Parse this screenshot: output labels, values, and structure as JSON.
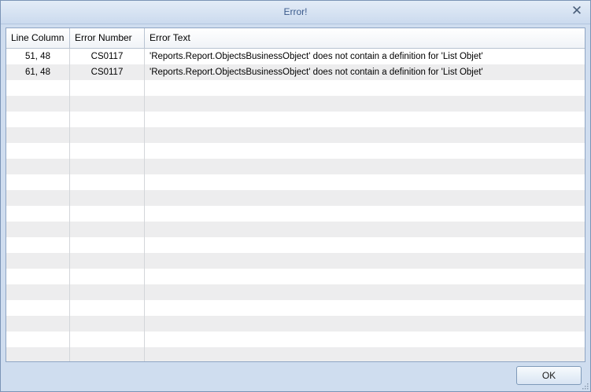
{
  "window": {
    "title": "Error!",
    "close_icon": "close-icon",
    "colors": {
      "frame": "#cfddef",
      "title_text": "#3b5b8c",
      "row_alt": "#ededee"
    }
  },
  "table": {
    "columns": [
      "Line Column",
      "Error Number",
      "Error Text"
    ],
    "rows": [
      {
        "line_column": "51, 48",
        "error_number": "CS0117",
        "error_text": "'Reports.Report.ObjectsBusinessObject' does not contain a definition for 'List  Objet'"
      },
      {
        "line_column": "61, 48",
        "error_number": "CS0117",
        "error_text": "'Reports.Report.ObjectsBusinessObject' does not contain a definition for 'List  Objet'"
      },
      {
        "line_column": "",
        "error_number": "",
        "error_text": ""
      },
      {
        "line_column": "",
        "error_number": "",
        "error_text": ""
      },
      {
        "line_column": "",
        "error_number": "",
        "error_text": ""
      },
      {
        "line_column": "",
        "error_number": "",
        "error_text": ""
      },
      {
        "line_column": "",
        "error_number": "",
        "error_text": ""
      },
      {
        "line_column": "",
        "error_number": "",
        "error_text": ""
      },
      {
        "line_column": "",
        "error_number": "",
        "error_text": ""
      },
      {
        "line_column": "",
        "error_number": "",
        "error_text": ""
      },
      {
        "line_column": "",
        "error_number": "",
        "error_text": ""
      },
      {
        "line_column": "",
        "error_number": "",
        "error_text": ""
      },
      {
        "line_column": "",
        "error_number": "",
        "error_text": ""
      },
      {
        "line_column": "",
        "error_number": "",
        "error_text": ""
      },
      {
        "line_column": "",
        "error_number": "",
        "error_text": ""
      },
      {
        "line_column": "",
        "error_number": "",
        "error_text": ""
      },
      {
        "line_column": "",
        "error_number": "",
        "error_text": ""
      },
      {
        "line_column": "",
        "error_number": "",
        "error_text": ""
      },
      {
        "line_column": "",
        "error_number": "",
        "error_text": ""
      },
      {
        "line_column": "",
        "error_number": "",
        "error_text": ""
      }
    ]
  },
  "footer": {
    "ok_label": "OK",
    "resize_icon": "resize-grip-icon"
  }
}
